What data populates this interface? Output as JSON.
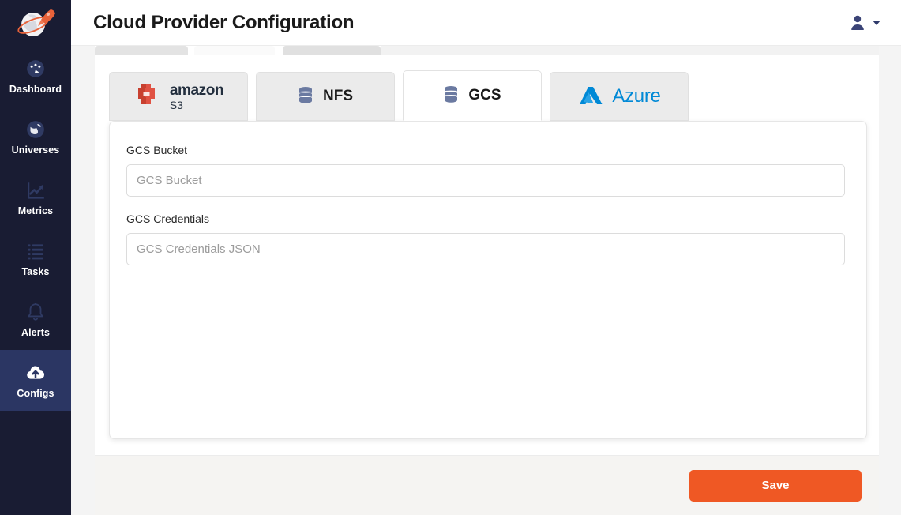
{
  "app": {
    "logo_icon": "rocket-globe-logo",
    "accent_color": "#EF5824",
    "sidebar_bg": "#191C33",
    "sidebar_active_bg": "#2B3663"
  },
  "sidebar": {
    "items": [
      {
        "label": "Dashboard",
        "icon": "gauge-icon",
        "active": false
      },
      {
        "label": "Universes",
        "icon": "globe-icon",
        "active": false
      },
      {
        "label": "Metrics",
        "icon": "line-chart-icon",
        "active": false
      },
      {
        "label": "Tasks",
        "icon": "list-icon",
        "active": false
      },
      {
        "label": "Alerts",
        "icon": "bell-icon",
        "active": false
      },
      {
        "label": "Configs",
        "icon": "cloud-upload-icon",
        "active": true
      }
    ]
  },
  "header": {
    "title": "Cloud Provider Configuration",
    "user_icon": "user-icon",
    "caret_icon": "chevron-down-icon"
  },
  "tabs": [
    {
      "id": "s3",
      "label": "amazon",
      "sublabel": "S3",
      "icon": "amazon-s3-icon",
      "active": false
    },
    {
      "id": "nfs",
      "label": "NFS",
      "sublabel": "",
      "icon": "database-icon",
      "active": false
    },
    {
      "id": "gcs",
      "label": "GCS",
      "sublabel": "",
      "icon": "database-icon",
      "active": true
    },
    {
      "id": "azure",
      "label": "Azure",
      "sublabel": "",
      "icon": "azure-icon",
      "active": false
    }
  ],
  "form": {
    "fields": [
      {
        "label": "GCS Bucket",
        "value": "",
        "placeholder": "GCS Bucket"
      },
      {
        "label": "GCS Credentials",
        "value": "",
        "placeholder": "GCS Credentials JSON"
      }
    ]
  },
  "footer": {
    "save_label": "Save"
  }
}
